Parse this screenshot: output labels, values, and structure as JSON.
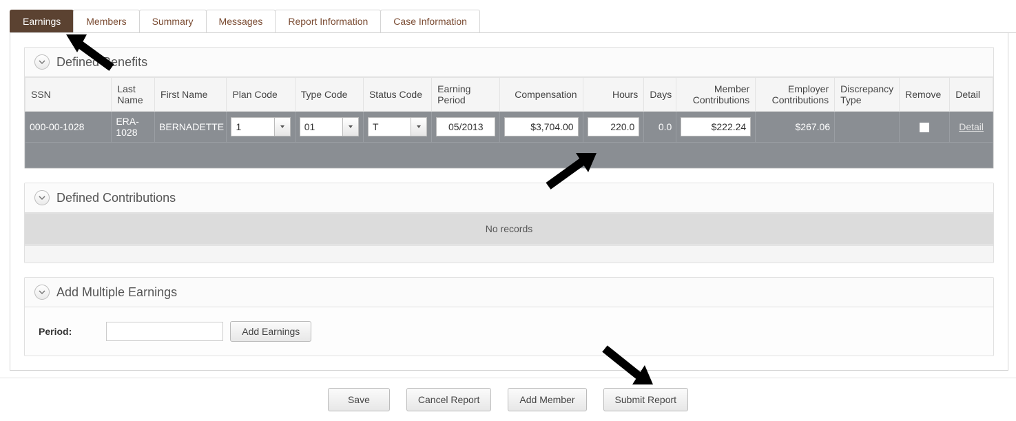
{
  "tabs": {
    "earnings": "Earnings",
    "members": "Members",
    "summary": "Summary",
    "messages": "Messages",
    "report_info": "Report Information",
    "case_info": "Case Information"
  },
  "defined_benefits": {
    "title": "Defined Benefits",
    "headers": {
      "ssn": "SSN",
      "last_name": "Last Name",
      "first_name": "First Name",
      "plan_code": "Plan Code",
      "type_code": "Type Code",
      "status_code": "Status Code",
      "earning_period": "Earning Period",
      "compensation": "Compensation",
      "hours": "Hours",
      "days": "Days",
      "member_contrib": "Member Contributions",
      "employer_contrib": "Employer Contributions",
      "discrepancy": "Discrepancy Type",
      "remove": "Remove",
      "detail": "Detail"
    },
    "row": {
      "ssn": "000-00-1028",
      "last_name": "ERA-1028",
      "first_name": "BERNADETTE",
      "plan_code": "1",
      "type_code": "01",
      "status_code": "T",
      "earning_period": "05/2013",
      "compensation": "$3,704.00",
      "hours": "220.0",
      "days": "0.0",
      "member_contrib": "$222.24",
      "employer_contrib": "$267.06",
      "discrepancy": "",
      "detail_link": "Detail"
    }
  },
  "defined_contributions": {
    "title": "Defined Contributions",
    "no_records": "No records"
  },
  "add_multiple": {
    "title": "Add Multiple Earnings",
    "period_label": "Period:",
    "period_value": "",
    "add_button": "Add Earnings"
  },
  "buttons": {
    "save": "Save",
    "cancel": "Cancel Report",
    "add_member": "Add Member",
    "submit": "Submit Report"
  }
}
